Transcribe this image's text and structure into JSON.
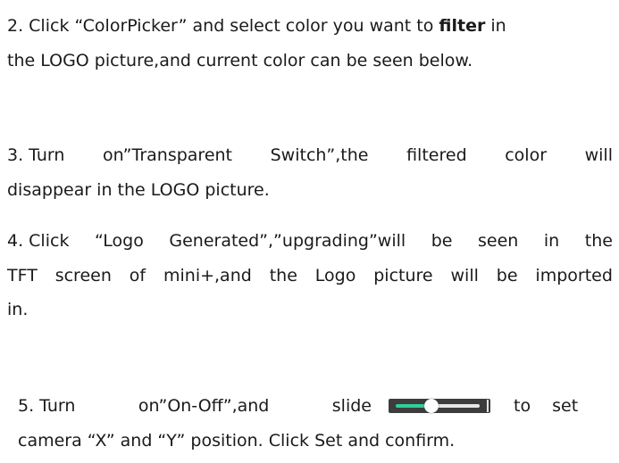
{
  "step2": {
    "line1_pre": "2. Click “ColorPicker” and select color you want to ",
    "line1_bold": "filter",
    "line1_post": " in",
    "line2": "the LOGO picture,and current color can be seen below."
  },
  "step3": {
    "line1_words": [
      "3. Turn",
      "on”Transparent",
      "Switch”,the",
      "filtered",
      "color",
      "will"
    ],
    "line2": "disappear in the LOGO picture."
  },
  "step4": {
    "line1_words": [
      "4. Click",
      "“Logo",
      "Generated”,”upgrading”will",
      "be",
      "seen",
      "in",
      "the"
    ],
    "line2_words": [
      "TFT",
      "screen",
      "of",
      "mini+,and",
      "the",
      "Logo",
      "picture",
      "will",
      "be",
      "imported"
    ],
    "line3": "in."
  },
  "step5": {
    "line1_pre_words": [
      "5. Turn",
      "on”On-Off”,and",
      "slide"
    ],
    "line1_post": "to set",
    "line2": "camera “X” and “Y” position. Click Set and confirm.",
    "slider_value": 0.43,
    "slider_colors": {
      "background": "#3d3d3d",
      "fill": "#2fcf9a",
      "rest": "#e6e6e6"
    }
  }
}
